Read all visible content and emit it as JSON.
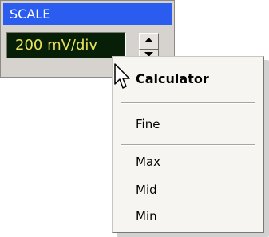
{
  "scale": {
    "title": "SCALE",
    "value": "200 mV/div"
  },
  "spinner": {
    "up_icon": "arrow-up-icon",
    "down_icon": "arrow-down-icon"
  },
  "context_menu": {
    "items": [
      {
        "label": "Calculator",
        "bold": true
      },
      {
        "label": "Fine",
        "bold": false
      },
      {
        "label": "Max",
        "bold": false
      },
      {
        "label": "Mid",
        "bold": false
      },
      {
        "label": "Min",
        "bold": false
      }
    ]
  },
  "cursor": {
    "icon": "mouse-pointer-icon"
  },
  "colors": {
    "header_bg": "#2a5cf0",
    "display_bg": "#071e07",
    "display_text": "#e8e45a",
    "panel_bg": "#d6d3ce",
    "menu_bg": "#f6f5f1"
  }
}
